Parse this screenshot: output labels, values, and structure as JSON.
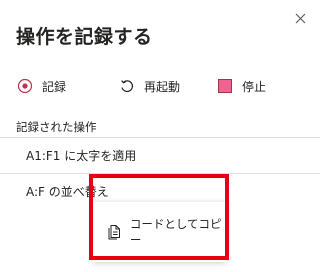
{
  "panel": {
    "title": "操作を記録する",
    "close_icon": "close-icon"
  },
  "toolbar": {
    "record_label": "記録",
    "restart_label": "再起動",
    "stop_label": "停止",
    "record_icon": "record-icon",
    "restart_icon": "restart-icon",
    "stop_icon": "stop-icon",
    "colors": {
      "record_ring": "#c4314b",
      "stop_fill": "#f06292",
      "stop_border": "#a4373a"
    }
  },
  "recorded": {
    "section_label": "記録された操作",
    "items": [
      {
        "label": "A1:F1 に太字を適用"
      },
      {
        "label": "A:F の並べ替え"
      }
    ]
  },
  "context_menu": {
    "copy_as_code_label": "コードとしてコピー",
    "copy_icon": "copy-code-icon"
  },
  "highlight": {
    "color": "#e60012"
  }
}
